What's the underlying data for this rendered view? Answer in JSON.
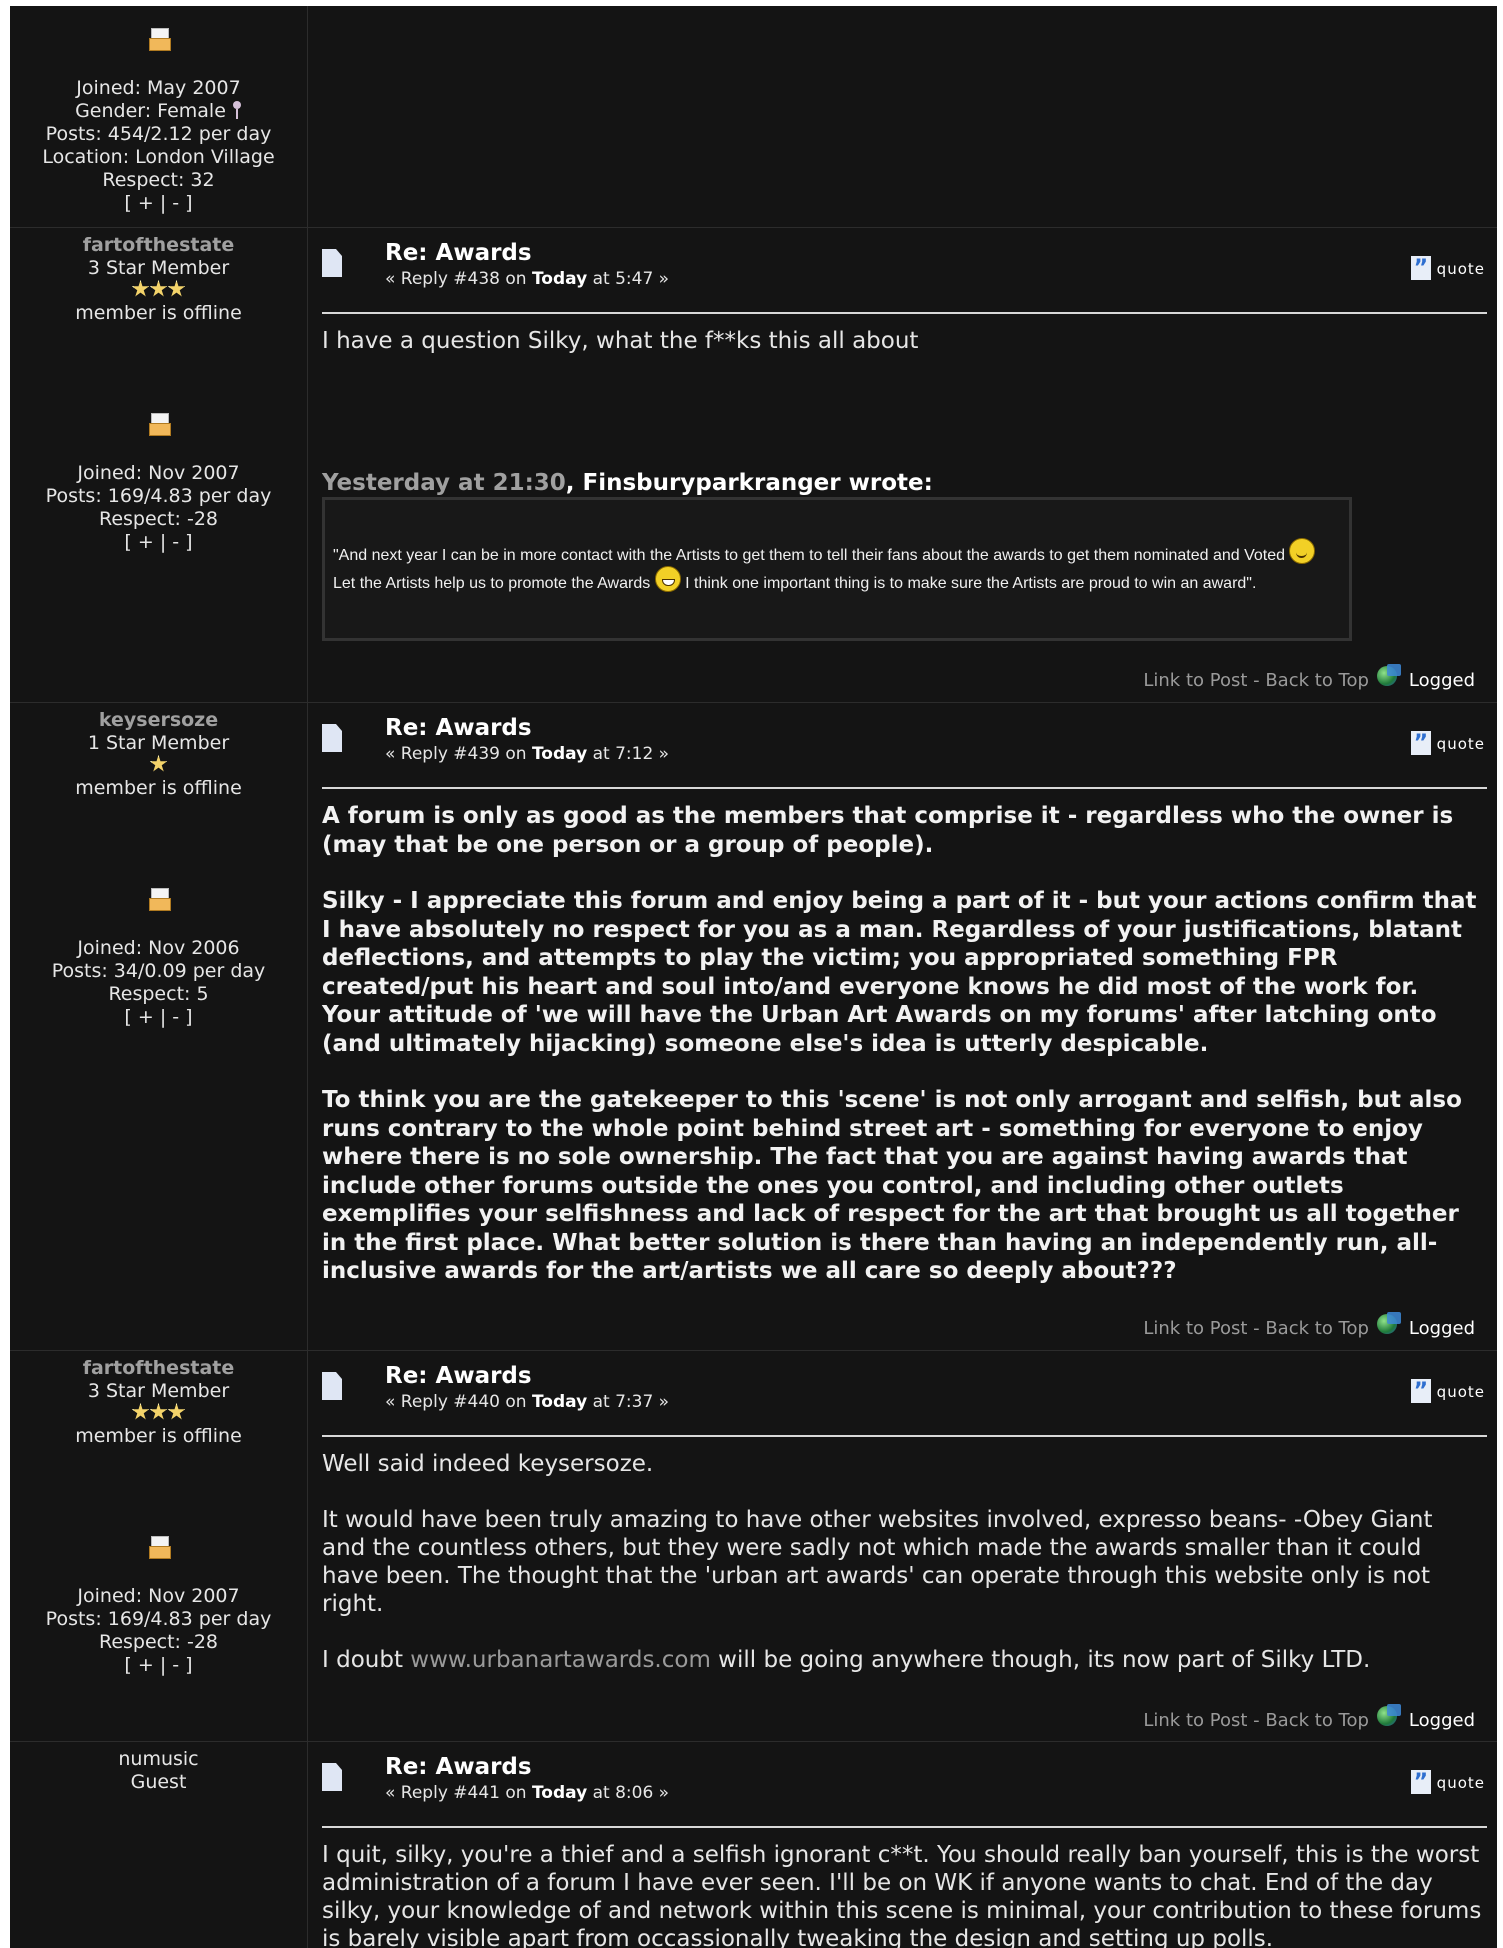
{
  "posts": [
    {
      "side": {
        "joined": "Joined: May 2007",
        "gender": "Gender: Female",
        "posts": "Posts: 454/2.12 per day",
        "location": "Location: London Village",
        "respect": "Respect: 32",
        "respect_controls": "[ + | - ]"
      }
    },
    {
      "side": {
        "username": "fartofthestate",
        "rank": "3 Star Member",
        "stars": 3,
        "status": "member is offline",
        "joined": "Joined: Nov 2007",
        "posts": "Posts: 169/4.83 per day",
        "respect": "Respect: -28",
        "respect_controls": "[ + | - ]"
      },
      "title": "Re: Awards",
      "reply": "« Reply #438 on ",
      "reply_day": "Today",
      "reply_time": " at 5:47 »",
      "quote_label": "quote",
      "body": "I have a question Silky, what the f**ks this all about",
      "quote_date": "Yesterday at 21:30",
      "quote_author": ", Finsburyparkranger wrote:",
      "quote_text_1": "\"And next year I can be in more contact with the Artists to get them to tell their fans about the awards to get them nominated and Voted ",
      "quote_text_2": " Let the Artists help us to promote the Awards ",
      "quote_text_3": " I think one important thing is to make sure the Artists are proud to win an award\".",
      "footer_links": "Link to Post - Back to Top",
      "logged": "Logged"
    },
    {
      "side": {
        "username": "keysersoze",
        "rank": "1 Star Member",
        "stars": 1,
        "status": "member is offline",
        "joined": "Joined: Nov 2006",
        "posts": "Posts: 34/0.09 per day",
        "respect": "Respect: 5",
        "respect_controls": "[ + | - ]"
      },
      "title": "Re: Awards",
      "reply": "« Reply #439 on ",
      "reply_day": "Today",
      "reply_time": " at 7:12 »",
      "quote_label": "quote",
      "paragraphs": [
        "A forum is only as good as the members that comprise it - regardless who the owner is (may that be one person or a group of people).",
        "Silky - I appreciate this forum and enjoy being a part of it - but your actions confirm that I have absolutely no respect for you as a man. Regardless of your justifications, blatant deflections, and attempts to play the victim; you appropriated something FPR created/put his heart and soul into/and everyone knows he did most of the work for. Your attitude of 'we will have the Urban Art Awards on my forums' after latching onto (and ultimately hijacking) someone else's idea is utterly despicable.",
        "To think you are the gatekeeper to this 'scene' is not only arrogant and selfish, but also runs contrary to the whole point behind street art - something for everyone to enjoy where there is no sole ownership. The fact that you are against having awards that include other forums outside the ones you control, and including other outlets exemplifies your selfishness and lack of respect for the art that brought us all together in the first place. What better solution is there than having an independently run, all-inclusive awards for the art/artists we all care so deeply about???"
      ],
      "footer_links": "Link to Post - Back to Top",
      "logged": "Logged"
    },
    {
      "side": {
        "username": "fartofthestate",
        "rank": "3 Star Member",
        "stars": 3,
        "status": "member is offline",
        "joined": "Joined: Nov 2007",
        "posts": "Posts: 169/4.83 per day",
        "respect": "Respect: -28",
        "respect_controls": "[ + | - ]"
      },
      "title": "Re: Awards",
      "reply": "« Reply #440 on ",
      "reply_day": "Today",
      "reply_time": " at 7:37 »",
      "quote_label": "quote",
      "paragraphs": [
        "Well said indeed keysersoze.",
        "It would have been truly amazing to have other websites involved, expresso beans- -Obey Giant and the countless others, but they were sadly not which made the awards smaller than it could have been. The thought that the 'urban art awards' can operate through this website only is not right."
      ],
      "last_before": "I doubt ",
      "last_link": "www.urbanartawards.com",
      "last_after": " will be going anywhere though, its now part of Silky LTD.",
      "footer_links": "Link to Post - Back to Top",
      "logged": "Logged"
    },
    {
      "side": {
        "username": "numusic",
        "rank": "Guest"
      },
      "title": "Re: Awards",
      "reply": "« Reply #441 on ",
      "reply_day": "Today",
      "reply_time": " at 8:06 »",
      "quote_label": "quote",
      "body": "I quit, silky, you're a thief and a selfish ignorant c**t. You should really ban yourself, this is the worst administration of a forum I have ever seen. I'll be on WK if anyone wants to chat. End of the day silky, your knowledge of and network within this scene is minimal, your contribution to these forums is barely visible apart from occassionally tweaking the design and setting up polls."
    }
  ]
}
